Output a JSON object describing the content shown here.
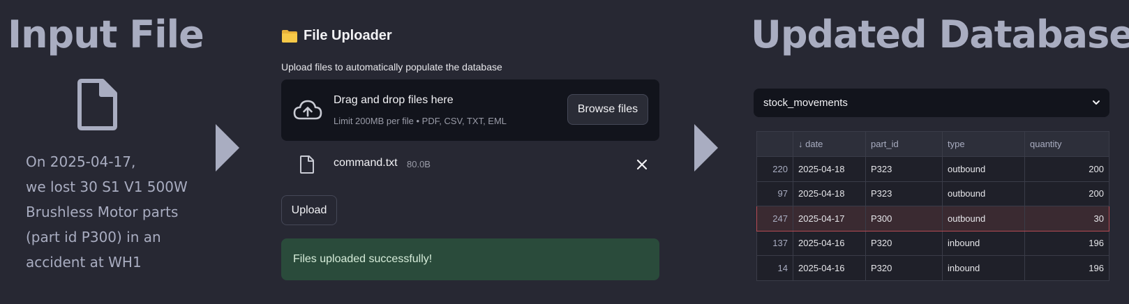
{
  "left": {
    "title": "Input File",
    "lines": [
      "On 2025-04-17,",
      "we lost 30 S1 V1 500W",
      "Brushless Motor parts",
      "(part id P300) in an",
      "accident at WH1"
    ]
  },
  "uploader": {
    "title": "File Uploader",
    "description": "Upload files to automatically populate the database",
    "drop_main": "Drag and drop files here",
    "drop_limit": "Limit 200MB per file • PDF, CSV, TXT, EML",
    "browse_label": "Browse files",
    "file_name": "command.txt",
    "file_size": "80.0B",
    "upload_label": "Upload",
    "success_message": "Files uploaded successfully!"
  },
  "right": {
    "title": "Updated Database",
    "select_value": "stock_movements",
    "columns": [
      "",
      "↓ date",
      "part_id",
      "type",
      "quantity"
    ],
    "rows": [
      [
        "220",
        "2025-04-18",
        "P323",
        "outbound",
        "200"
      ],
      [
        "97",
        "2025-04-18",
        "P323",
        "outbound",
        "200"
      ],
      [
        "247",
        "2025-04-17",
        "P300",
        "outbound",
        "30"
      ],
      [
        "137",
        "2025-04-16",
        "P320",
        "inbound",
        "196"
      ],
      [
        "14",
        "2025-04-16",
        "P320",
        "inbound",
        "196"
      ]
    ],
    "highlight_row": 2
  },
  "colors": {
    "background": "#272833",
    "title": "#a9adc1",
    "success_bg": "#2a4b3b",
    "highlight_border": "#b54a53"
  },
  "icons": {
    "file": "file-icon",
    "folder": "folder-icon",
    "cloud": "cloud-upload-icon",
    "close": "close-icon",
    "chevron": "chevron-down-icon"
  }
}
